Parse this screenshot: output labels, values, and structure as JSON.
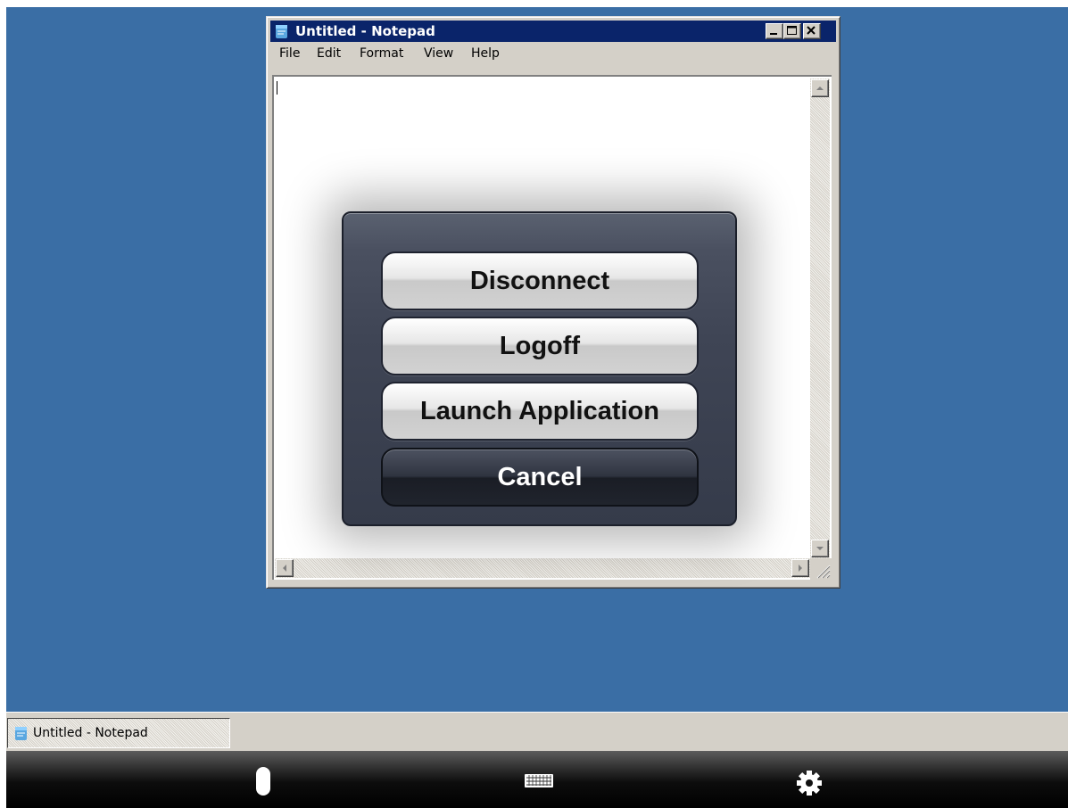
{
  "notepad": {
    "title": "Untitled - Notepad",
    "menu": [
      "File",
      "Edit",
      "Format",
      "View",
      "Help"
    ],
    "controls": [
      "minimize",
      "maximize",
      "close"
    ]
  },
  "dialog": {
    "buttons": {
      "disconnect": "Disconnect",
      "logoff": "Logoff",
      "launch": "Launch Application",
      "cancel": "Cancel"
    }
  },
  "taskbar": {
    "items": [
      {
        "label": "Untitled - Notepad",
        "icon": "notepad-icon"
      }
    ]
  },
  "toolbar": {
    "icons": [
      "mouse-icon",
      "keyboard-icon",
      "gear-icon"
    ]
  },
  "colors": {
    "desktop": "#3a6ea5",
    "titlebar": "#0a246a",
    "window_face": "#d4d0c8"
  }
}
